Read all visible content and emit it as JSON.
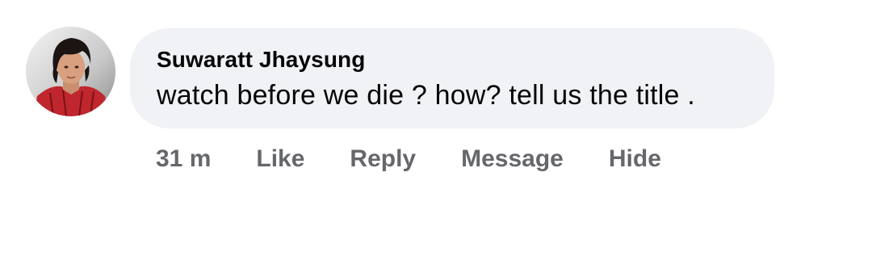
{
  "comment": {
    "author": "Suwaratt Jhaysung",
    "text": "watch before we die ? how? tell us the title .",
    "timestamp": "31 m",
    "actions": {
      "like": "Like",
      "reply": "Reply",
      "message": "Message",
      "hide": "Hide"
    },
    "colors": {
      "bubble_background": "#f0f2f5",
      "author_text": "#050505",
      "action_text": "#65676b"
    }
  }
}
